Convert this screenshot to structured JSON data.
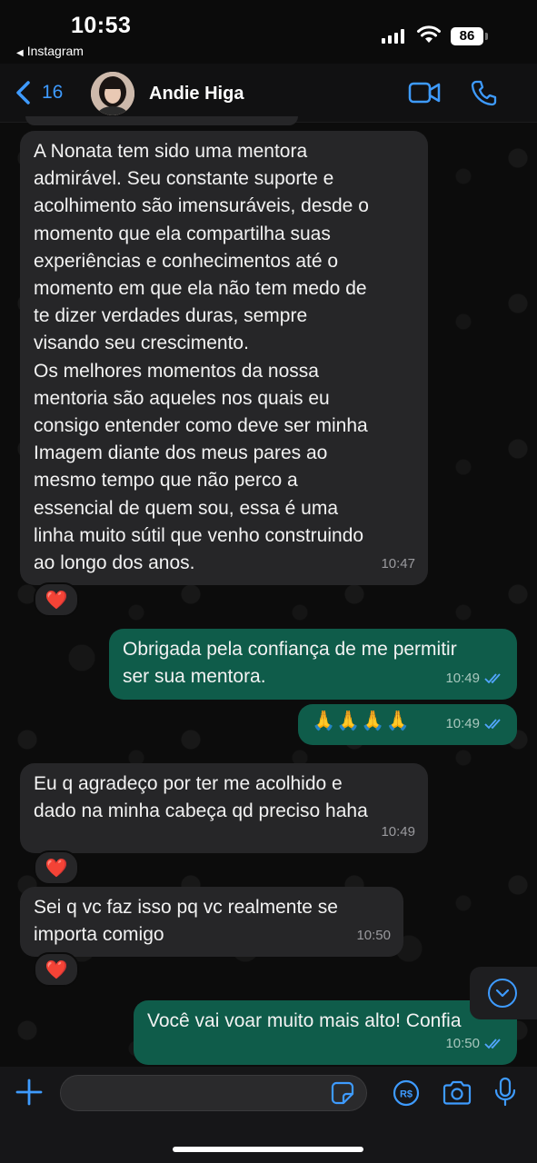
{
  "status_bar": {
    "time": "10:53",
    "back_app": "Instagram",
    "battery": "86"
  },
  "header": {
    "back_count": "16",
    "contact_name": "Andie Higa"
  },
  "messages": [
    {
      "direction": "incoming",
      "text": "A Nonata tem sido uma mentora\nadmirável. Seu constante suporte e\nacolhimento são imensuráveis, desde o\nmomento que ela compartilha suas\nexperiências e conhecimentos até o\nmomento em que ela não tem medo de\nte dizer verdades duras, sempre\nvisando seu crescimento.\nOs melhores momentos da nossa\nmentoria são aqueles nos quais eu\nconsigo entender como deve ser minha\nImagem diante dos meus pares ao\nmesmo tempo que não perco a\nessencial de quem sou, essa é uma\nlinha muito sútil que venho construindo\nao longo dos anos.",
      "time": "10:47",
      "reaction": "❤️"
    },
    {
      "direction": "outgoing",
      "text": "Obrigada pela confiança de me permitir\nser sua mentora.",
      "time": "10:49",
      "status": "read"
    },
    {
      "direction": "outgoing",
      "text": "🙏🙏🙏🙏",
      "time": "10:49",
      "status": "read"
    },
    {
      "direction": "incoming",
      "text": "Eu q agradeço por ter me acolhido e\ndado na minha cabeça qd preciso haha",
      "time": "10:49",
      "reaction": "❤️"
    },
    {
      "direction": "incoming",
      "text": "Sei q vc faz isso pq vc realmente se\nimporta comigo",
      "time": "10:50",
      "reaction": "❤️"
    },
    {
      "direction": "outgoing",
      "text": "Você vai voar muito mais alto! Confia",
      "time": "10:50",
      "status": "read"
    }
  ],
  "input_bar": {
    "placeholder": ""
  },
  "colors": {
    "accent": "#3e9bff",
    "incoming_bubble": "#262628",
    "outgoing_bubble": "#0f5c4a",
    "read_ticks": "#53a6ff",
    "reaction_heart": "#ff2d3a"
  },
  "icons": {
    "back": "chevron-left-icon",
    "video": "video-camera-icon",
    "call": "phone-icon",
    "scroll_down": "chevron-down-circle-icon",
    "plus": "plus-icon",
    "sticker": "sticker-icon",
    "pay": "payment-icon",
    "camera": "camera-icon",
    "mic": "microphone-icon"
  }
}
